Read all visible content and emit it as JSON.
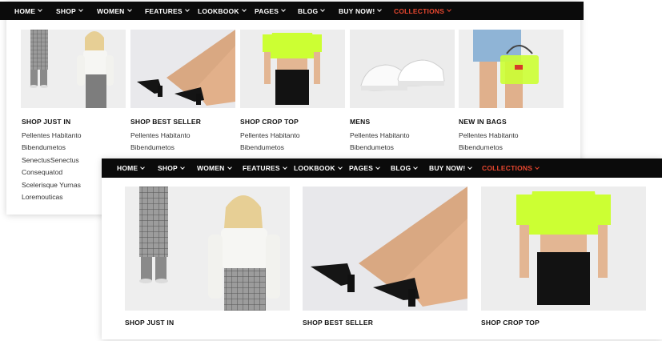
{
  "nav": {
    "items": [
      {
        "label": "HOME"
      },
      {
        "label": "SHOP"
      },
      {
        "label": "WOMEN"
      },
      {
        "label": "FEATURES"
      },
      {
        "label": "LOOKBOOK"
      },
      {
        "label": "PAGES"
      },
      {
        "label": "BLOG"
      },
      {
        "label": "BUY NOW!"
      },
      {
        "label": "COLLECTIONS"
      }
    ],
    "active_color": "#e8472f",
    "bar_color": "#0b0b0b"
  },
  "back_menu": {
    "columns": [
      {
        "title": "SHOP JUST IN",
        "image": "woman-plaid-pants-photo",
        "links": [
          "Pellentes Habitanto",
          "Bibendumetos",
          "SenectusSenectus",
          "Consequatod",
          "Scelerisque Yurnas",
          "Loremouticas"
        ]
      },
      {
        "title": "SHOP BEST SELLER",
        "image": "black-strappy-heels-photo",
        "links": [
          "Pellentes Habitanto",
          "Bibendumetos"
        ]
      },
      {
        "title": "SHOP CROP TOP",
        "image": "neon-crop-top-photo",
        "links": [
          "Pellentes Habitanto",
          "Bibendumetos"
        ]
      },
      {
        "title": "MENS",
        "image": "white-sneakers-photo",
        "links": [
          "Pellentes Habitanto",
          "Bibendumetos"
        ]
      },
      {
        "title": "NEW IN BAGS",
        "image": "neon-clear-bag-photo",
        "links": [
          "Pellentes Habitanto",
          "Bibendumetos"
        ]
      }
    ]
  },
  "front_menu": {
    "columns": [
      {
        "title": "SHOP JUST IN",
        "image": "woman-plaid-pants-photo"
      },
      {
        "title": "SHOP BEST SELLER",
        "image": "black-strappy-heels-photo"
      },
      {
        "title": "SHOP CROP TOP",
        "image": "neon-crop-top-photo"
      }
    ]
  }
}
